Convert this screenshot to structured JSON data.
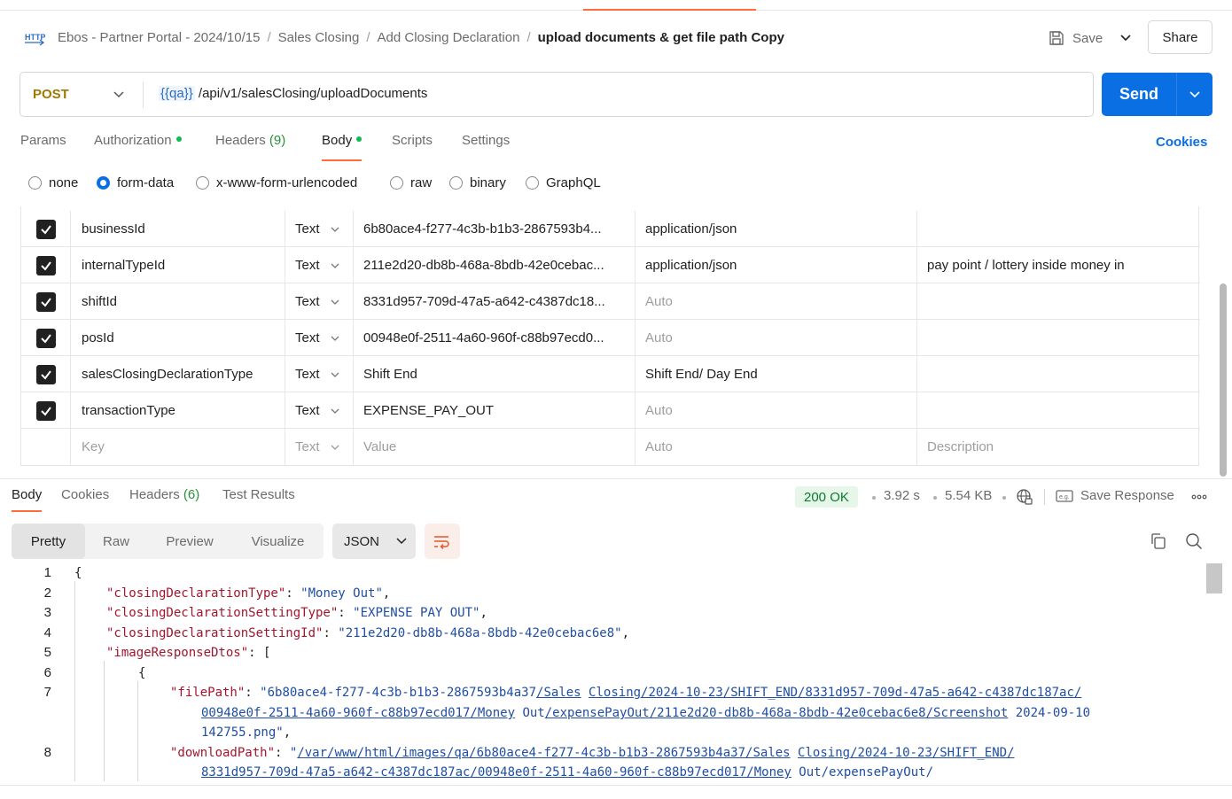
{
  "breadcrumb": {
    "items": [
      "Ebos - Partner Portal - 2024/10/15",
      "Sales Closing",
      "Add Closing Declaration"
    ],
    "current": "upload documents & get file path Copy",
    "separator": "/"
  },
  "header": {
    "save_label": "Save",
    "share_label": "Share"
  },
  "request": {
    "method": "POST",
    "url_variable": "{{qa}}",
    "url_path": " /api/v1/salesClosing/uploadDocuments",
    "send_label": "Send"
  },
  "request_tabs": {
    "params": "Params",
    "authorization": "Authorization",
    "headers": "Headers",
    "headers_count": "(9)",
    "body": "Body",
    "scripts": "Scripts",
    "settings": "Settings",
    "cookies": "Cookies"
  },
  "body_types": {
    "none": "none",
    "form_data": "form-data",
    "urlencoded": "x-www-form-urlencoded",
    "raw": "raw",
    "binary": "binary",
    "graphql": "GraphQL",
    "selected": "form-data"
  },
  "form_rows": [
    {
      "key": "businessId",
      "type": "Text",
      "value": "6b80ace4-f277-4c3b-b1b3-2867593b4...",
      "content_type": "application/json",
      "description": ""
    },
    {
      "key": "internalTypeId",
      "type": "Text",
      "value": "211e2d20-db8b-468a-8bdb-42e0cebac...",
      "content_type": "application/json",
      "description": "pay point / lottery inside money in"
    },
    {
      "key": "shiftId",
      "type": "Text",
      "value": "8331d957-709d-47a5-a642-c4387dc18...",
      "content_type": "Auto",
      "description": ""
    },
    {
      "key": "posId",
      "type": "Text",
      "value": "00948e0f-2511-4a60-960f-c88b97ecd0...",
      "content_type": "Auto",
      "description": ""
    },
    {
      "key": "salesClosingDeclarationType",
      "type": "Text",
      "value": "Shift End",
      "content_type": "Shift End/ Day End",
      "description": ""
    },
    {
      "key": "transactionType",
      "type": "Text",
      "value": "EXPENSE_PAY_OUT",
      "content_type": "Auto",
      "description": ""
    }
  ],
  "form_placeholder": {
    "key": "Key",
    "type": "Text",
    "value": "Value",
    "content_type": "Auto",
    "description": "Description"
  },
  "response_tabs": {
    "body": "Body",
    "cookies": "Cookies",
    "headers": "Headers",
    "headers_count": "(6)",
    "test_results": "Test Results"
  },
  "response_meta": {
    "status": "200 OK",
    "time": "3.92 s",
    "size": "5.54 KB",
    "save_response": "Save Response"
  },
  "view_modes": {
    "pretty": "Pretty",
    "raw": "Raw",
    "preview": "Preview",
    "visualize": "Visualize",
    "format": "JSON"
  },
  "code": {
    "line_numbers": [
      "1",
      "2",
      "3",
      "4",
      "5",
      "6",
      "7",
      "",
      "",
      "8",
      ""
    ],
    "l1": "{",
    "l2_key": "\"closingDeclarationType\"",
    "l2_val": "\"Money Out\"",
    "l3_key": "\"closingDeclarationSettingType\"",
    "l3_val": "\"EXPENSE PAY OUT\"",
    "l4_key": "\"closingDeclarationSettingId\"",
    "l4_val": "\"211e2d20-db8b-468a-8bdb-42e0cebac6e8\"",
    "l5_key": "\"imageResponseDtos\"",
    "l5_rest": ": [",
    "l6": "{",
    "l7_key": "\"filePath\"",
    "l7_a": "\"6b80ace4-f277-4c3b-b1b3-2867593b4a37",
    "l7_b": "/Sales",
    "l7_c": " ",
    "l7_d": "Closing/2024-10-23/SHIFT_END/8331d957-709d-47a5-a642-c4387dc187ac/",
    "l7w1_a": "00948e0f-2511-4a60-960f-c88b97ecd017/Money",
    "l7w1_b": " Out",
    "l7w1_c": "/expensePayOut/211e2d20-db8b-468a-8bdb-42e0cebac6e8/Screenshot",
    "l7w1_d": " 2024-09-10",
    "l7w2": "142755.png\"",
    "l8_key": "\"downloadPath\"",
    "l8_a": "\"",
    "l8_b": "/var/www/html/images/qa/6b80ace4-f277-4c3b-b1b3-2867593b4a37/Sales",
    "l8_c": " ",
    "l8_d": "Closing",
    "l8_e": "/2024-10-23/SHIFT_END/",
    "l8w1_a": "8331d957-709d-47a5-a642-c4387dc187ac/00948e0f-2511-4a60-960f-c88b97ecd017/Money",
    "l8w1_b": " Out/expensePayOut/"
  },
  "colors": {
    "send": "#0b6fe4",
    "accent": "#ff6c37",
    "method": "#a27800",
    "status_bg": "#e6f7ea",
    "json_key": "#a3152c",
    "json_string": "#1f4ea3"
  },
  "icons": [
    "http-icon",
    "save-icon",
    "chevron-down-icon",
    "checkbox-icon",
    "globe-icon",
    "save-response-icon",
    "more-icon",
    "wrap-icon",
    "copy-icon",
    "search-icon"
  ]
}
